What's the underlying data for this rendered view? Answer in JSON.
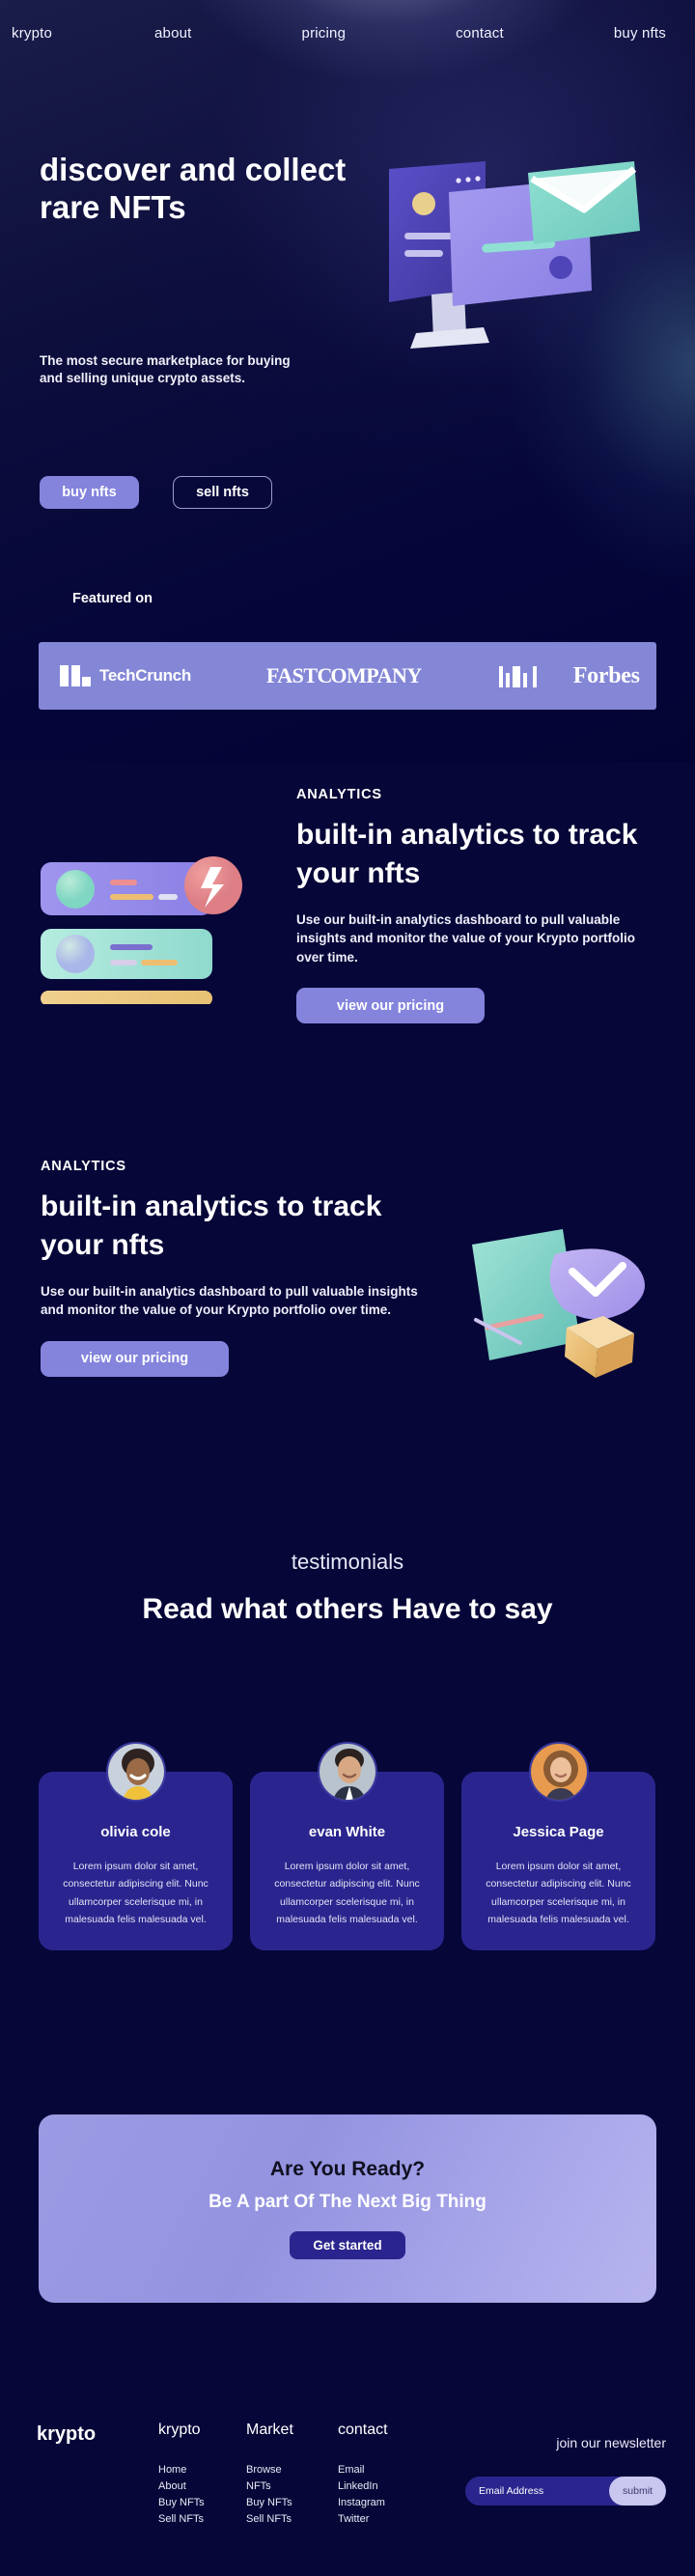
{
  "nav": {
    "brand": "krypto",
    "links": [
      {
        "label": "about"
      },
      {
        "label": "pricing"
      },
      {
        "label": "contact"
      },
      {
        "label": "buy nfts"
      }
    ]
  },
  "hero": {
    "title": "discover and collect rare NFTs",
    "subtitle": "The most secure marketplace for buying\nand selling unique crypto assets.",
    "primary_cta": "buy nfts",
    "secondary_cta": "sell nfts"
  },
  "featured": {
    "label": "Featured on",
    "bar_color": "#8487d6",
    "logos": [
      {
        "name": "TechCrunch"
      },
      {
        "name": "FAST COMPANY"
      },
      {
        "name": "MIT"
      },
      {
        "name": "Forbes"
      }
    ]
  },
  "analytics_1": {
    "eyebrow": "ANALYTICS",
    "title": "built-in analytics to track your nfts",
    "body": "Use our built-in analytics dashboard to pull valuable insights and monitor the value of your Krypto portfolio over time.",
    "cta": "view our pricing"
  },
  "analytics_2": {
    "eyebrow": "ANALYTICS",
    "title": "built-in analytics to track your nfts",
    "body": "Use our built-in analytics dashboard to pull valuable insights and monitor the value of your Krypto portfolio over time.",
    "cta": "view our pricing"
  },
  "testimonials": {
    "eyebrow": "testimonials",
    "title": "Read what others Have to say",
    "cards": [
      {
        "name": "olivia cole",
        "text": "Lorem ipsum dolor sit amet, consectetur adipiscing elit. Nunc ullamcorper scelerisque mi, in malesuada felis malesuada vel."
      },
      {
        "name": "evan White",
        "text": "Lorem ipsum dolor sit amet, consectetur adipiscing elit. Nunc ullamcorper scelerisque mi, in malesuada felis malesuada vel."
      },
      {
        "name": "Jessica Page",
        "text": "Lorem ipsum dolor sit amet, consectetur adipiscing elit. Nunc ullamcorper scelerisque mi, in malesuada felis malesuada vel."
      }
    ]
  },
  "cta": {
    "heading": "Are You Ready?",
    "subheading": "Be A part Of The Next Big Thing",
    "button": "Get started",
    "accent": "#9b9be4"
  },
  "footer": {
    "brand": "krypto",
    "columns": [
      {
        "title": "krypto",
        "links": [
          "Home",
          "About",
          "Buy NFTs",
          "Sell NFTs"
        ]
      },
      {
        "title": "Market",
        "links": [
          "Browse",
          "NFTs",
          "Buy NFTs",
          "Sell NFTs"
        ]
      },
      {
        "title": "contact",
        "links": [
          "Email",
          "LinkedIn",
          "Instagram",
          "Twitter"
        ]
      }
    ],
    "newsletter": {
      "title": "join our newsletter",
      "placeholder": "Email Address",
      "submit": "submit"
    }
  }
}
